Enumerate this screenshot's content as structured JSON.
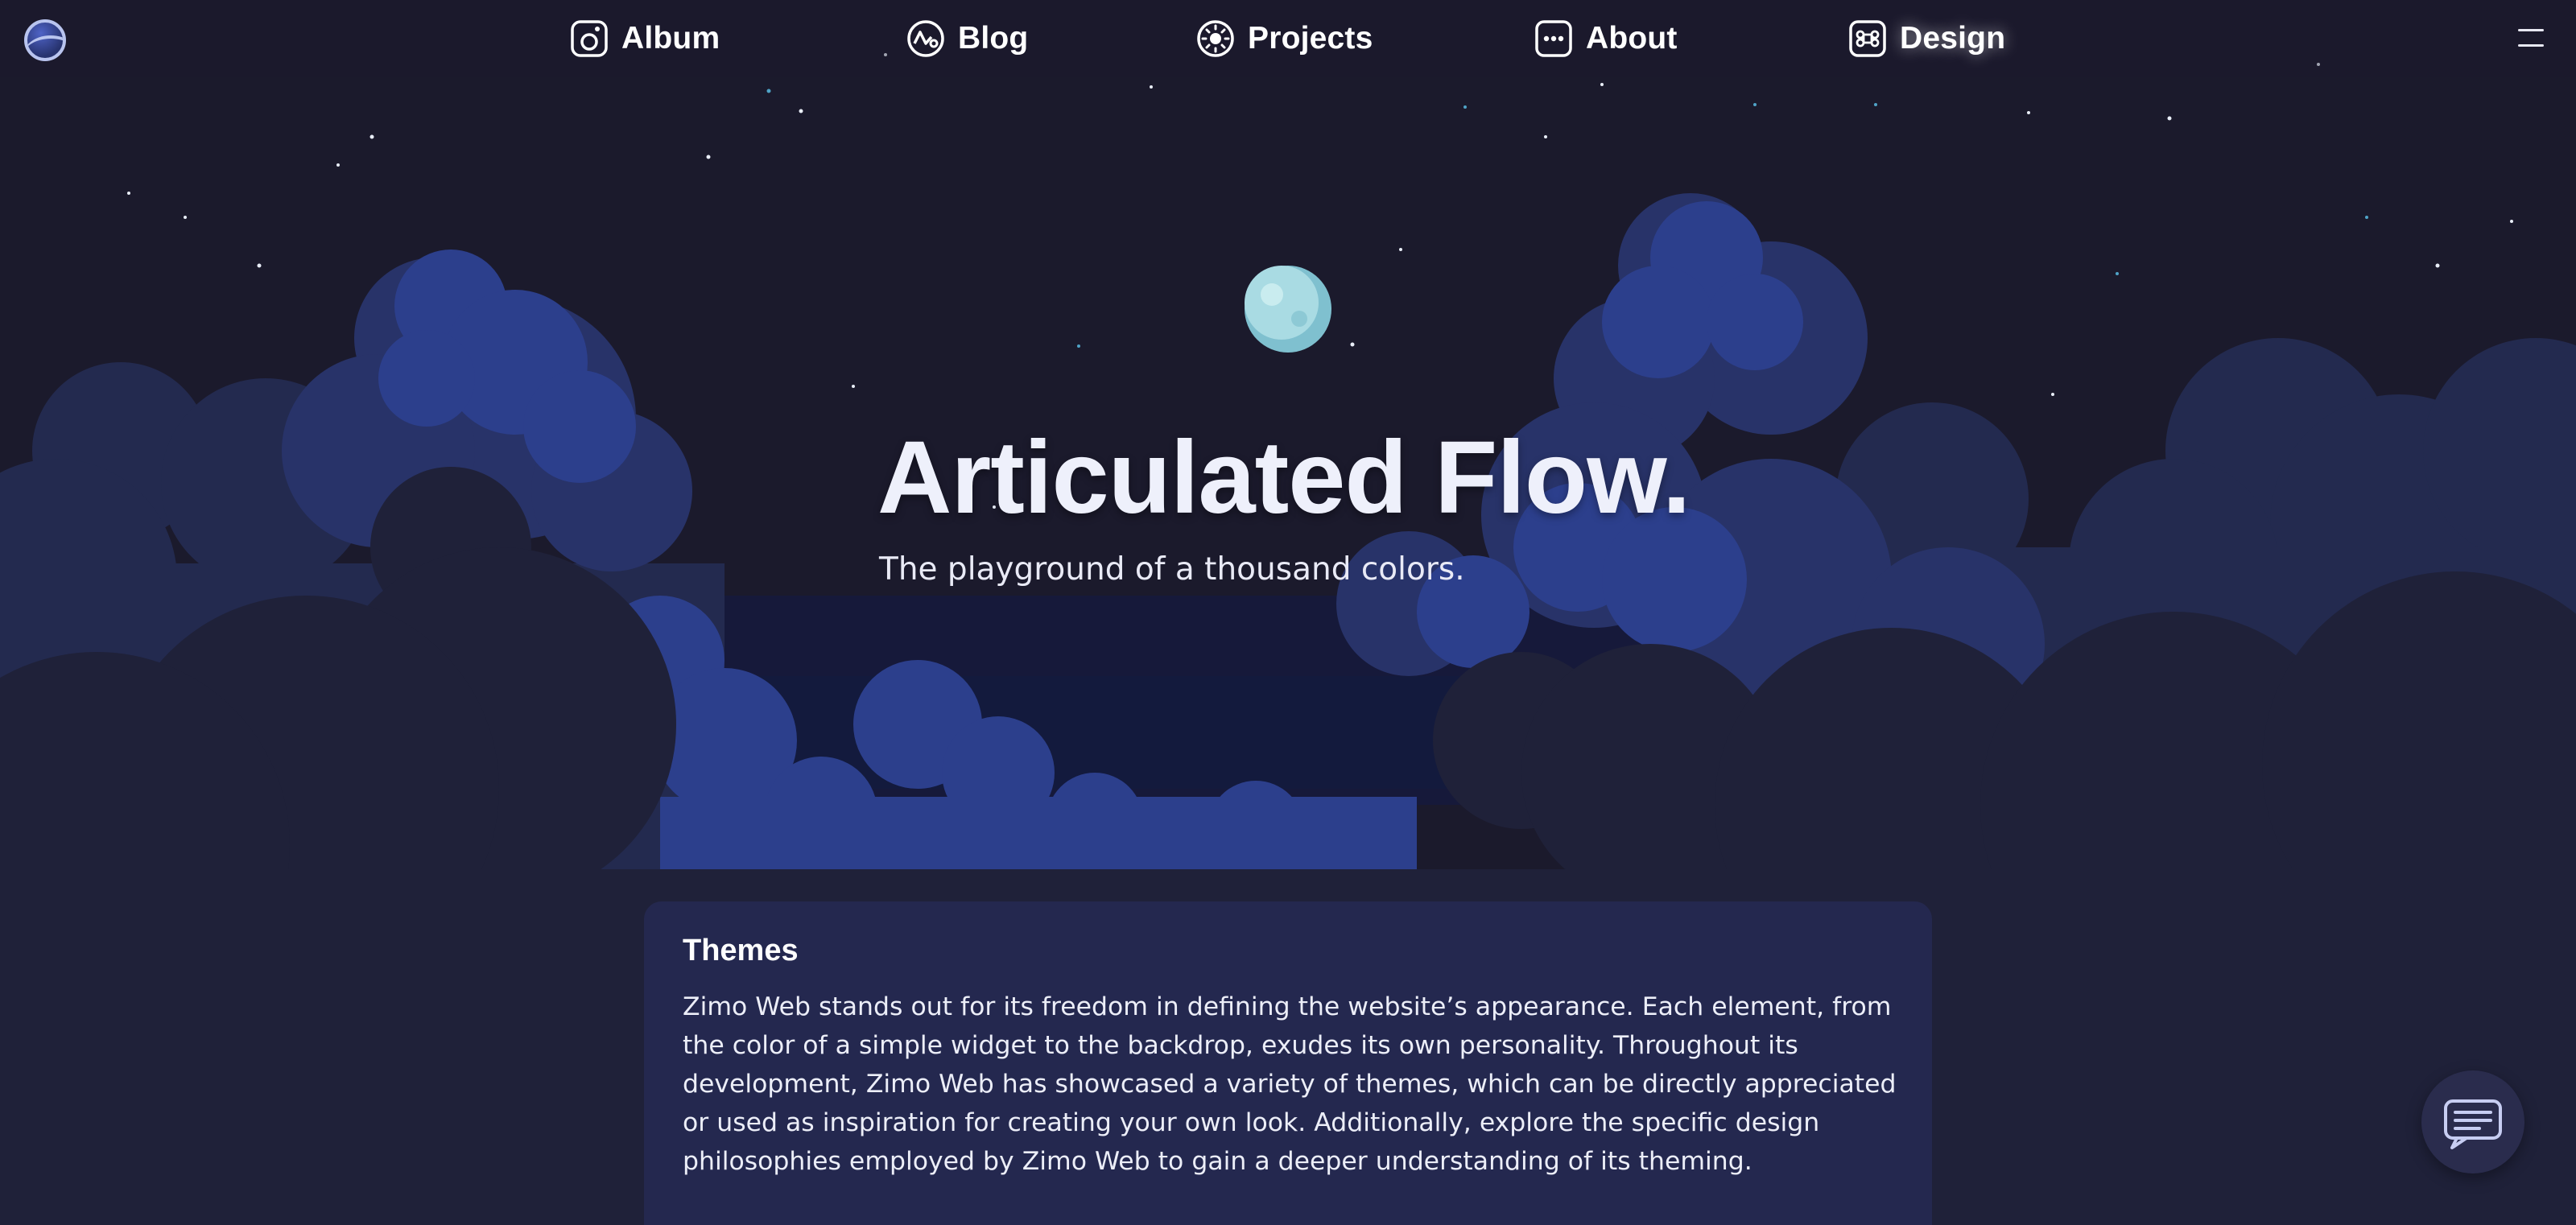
{
  "nav": {
    "items": [
      {
        "label": "Album",
        "icon": "album-icon"
      },
      {
        "label": "Blog",
        "icon": "blog-icon"
      },
      {
        "label": "Projects",
        "icon": "projects-icon"
      },
      {
        "label": "About",
        "icon": "about-icon"
      },
      {
        "label": "Design",
        "icon": "design-icon",
        "active": true
      }
    ]
  },
  "hero": {
    "title": "Articulated Flow.",
    "subtitle": "The playground of a thousand colors."
  },
  "card": {
    "title": "Themes",
    "body": "Zimo Web stands out for its freedom in defining the website’s appearance. Each element, from the color of a simple widget to the backdrop, exudes its own personality. Throughout its development, Zimo Web has showcased a variety of themes, which can be directly appreciated or used as inspiration for creating your own look. Additionally, explore the specific design philosophies employed by Zimo Web to gain a deeper understanding of its theming."
  },
  "colors": {
    "background": "#1b1a2c",
    "cloud_light": "#2c3f8c",
    "cloud_mid": "#283369",
    "cloud_dark": "#242a4f",
    "moon": "#9fd3dd",
    "card": "#262952"
  },
  "icons": {
    "logo": "site-logo-icon",
    "menu": "hamburger-menu-icon",
    "chat": "chat-icon"
  }
}
